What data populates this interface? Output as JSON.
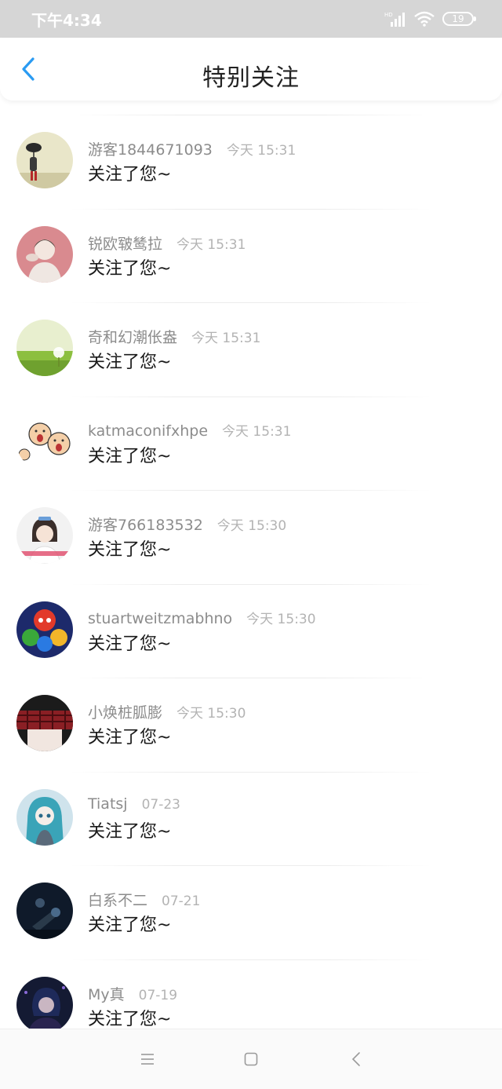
{
  "status_bar": {
    "time": "下午4:34",
    "network_label": "HD",
    "battery": "19"
  },
  "header": {
    "title": "特别关注",
    "back_icon": "chevron-left-icon",
    "accent_color": "#2a9bf2"
  },
  "items": [
    {
      "name": "游客1844671093",
      "time": "今天 15:31",
      "message": "关注了您~"
    },
    {
      "name": "锐欧皲鸶拉",
      "time": "今天 15:31",
      "message": "关注了您~"
    },
    {
      "name": "奇和幻潮伥盎",
      "time": "今天 15:31",
      "message": "关注了您~"
    },
    {
      "name": "katmaconifxhpe",
      "time": "今天 15:31",
      "message": "关注了您~"
    },
    {
      "name": "游客766183532",
      "time": "今天 15:30",
      "message": "关注了您~"
    },
    {
      "name": "stuartweitzmabhno",
      "time": "今天 15:30",
      "message": "关注了您~"
    },
    {
      "name": "小焕桩胍膨",
      "time": "今天 15:30",
      "message": "关注了您~"
    },
    {
      "name": "Tiatsj",
      "time": "07-23",
      "message": "关注了您~"
    },
    {
      "name": "白系不二",
      "time": "07-21",
      "message": "关注了您~"
    },
    {
      "name": "My真",
      "time": "07-19",
      "message": "关注了您~"
    }
  ],
  "bottom_nav": {
    "menu_icon": "menu-icon",
    "home_icon": "home-square-icon",
    "back_icon": "back-triangle-icon"
  }
}
